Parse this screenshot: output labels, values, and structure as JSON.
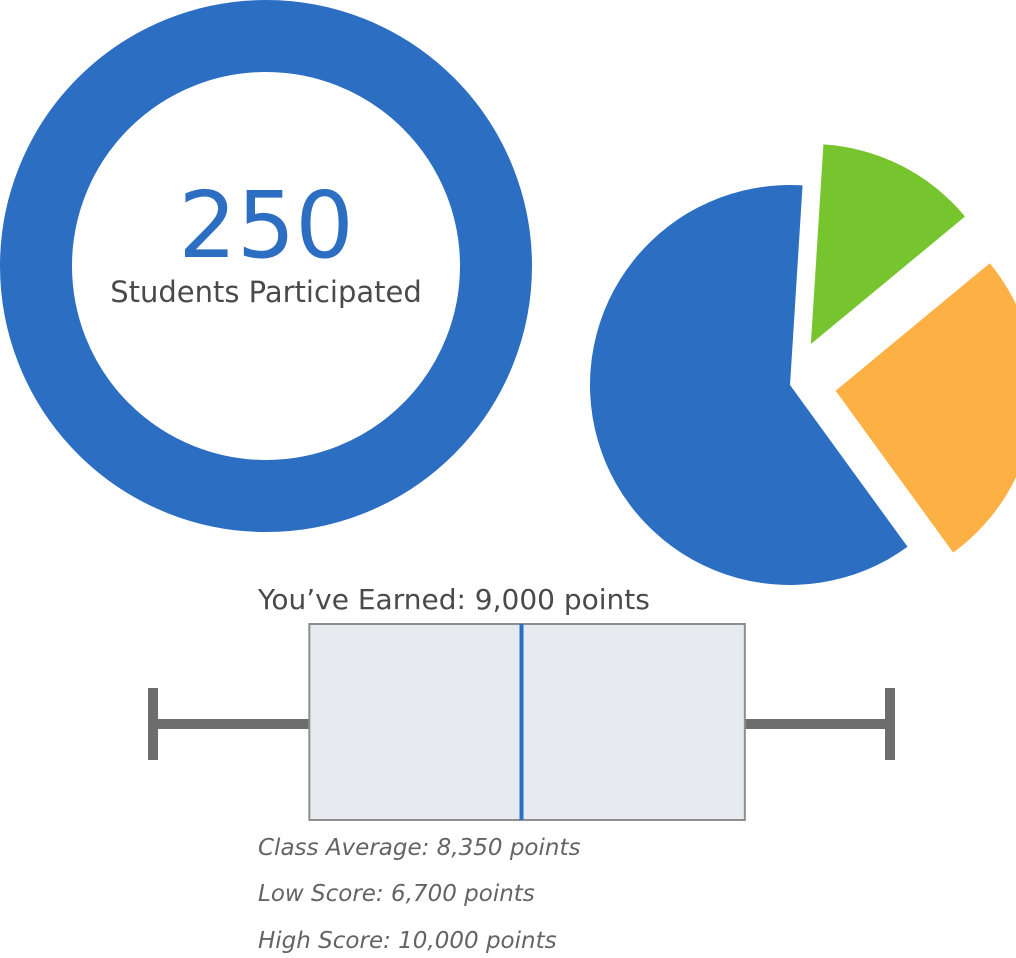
{
  "colors": {
    "blue": "#2b6ec2",
    "green": "#76c42e",
    "orange": "#fdb043",
    "gray": "#6d6d6d",
    "box_fill": "#e7eaef",
    "box_stroke": "#8e8e8e",
    "text_dark": "#4a4a4a",
    "text_italic": "#646464"
  },
  "participation": {
    "count": "250",
    "label": "Students Participated"
  },
  "chart_data": [
    {
      "type": "pie",
      "exploded": true,
      "slices": [
        {
          "value": 61,
          "color": "#2b6ec2"
        },
        {
          "value": 13,
          "color": "#76c42e"
        },
        {
          "value": 26,
          "color": "#fdb043"
        }
      ]
    },
    {
      "type": "box",
      "title": "You’ve Earned: 9,000 points",
      "whisker_low": 6700,
      "q1": 7400,
      "median": 8350,
      "q3": 9350,
      "whisker_high": 10000,
      "annotations": [
        "Class Average: 8,350 points",
        "Low Score: 6,700 points",
        "High Score: 10,000 points"
      ]
    }
  ]
}
